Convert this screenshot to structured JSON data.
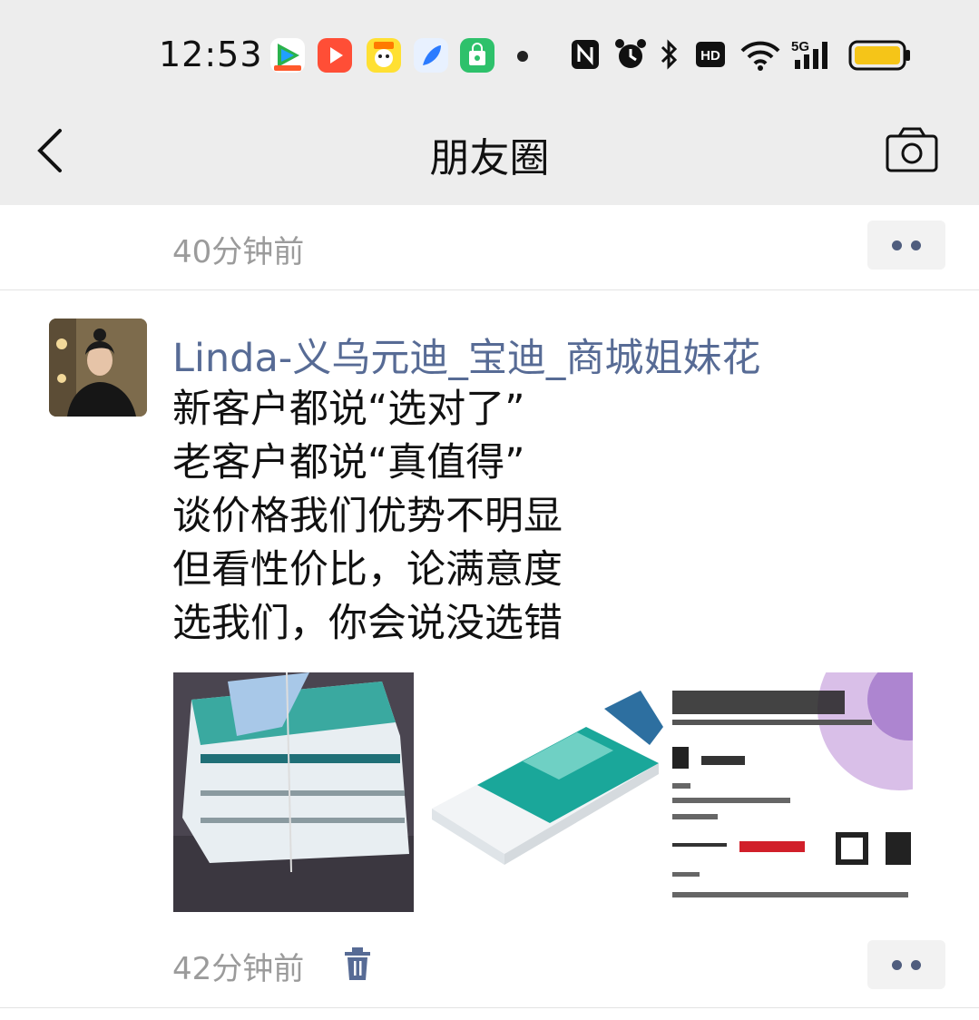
{
  "status_bar": {
    "time": "12:53",
    "app_icons": [
      "tencent-video-icon",
      "video-player-icon",
      "xianyu-icon",
      "feather-app-icon",
      "shopping-bag-icon"
    ],
    "system_icons": [
      "nfc-icon",
      "alarm-icon",
      "bluetooth-icon",
      "hd-icon",
      "wifi-icon",
      "5g-signal-icon",
      "battery-icon"
    ],
    "signal_label": "5G",
    "hd_label": "HD",
    "battery_color": "#f5c518"
  },
  "nav": {
    "title": "朋友圈"
  },
  "previous_post": {
    "time_ago": "40分钟前"
  },
  "post": {
    "username": "Linda-义乌元迪_宝迪_商城姐妹花",
    "lines": [
      "新客户都说“选对了”",
      "老客户都说“真值得”",
      "谈价格我们优势不明显",
      "但看性价比，论满意度",
      "选我们，你会说没选错"
    ],
    "images": [
      "stacked-paper-boxes-photo",
      "deli-a4-paper-ream-photo",
      "business-card-photo"
    ],
    "time_ago": "42分钟前"
  },
  "colors": {
    "username": "#576b95",
    "header_bg": "#ededed",
    "meta_gray": "#9b9b9b"
  }
}
